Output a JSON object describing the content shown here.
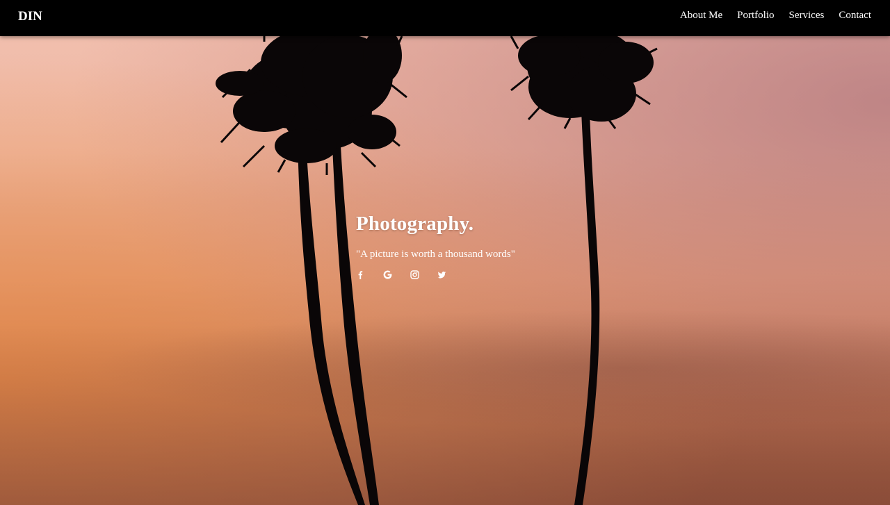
{
  "nav": {
    "brand": "DIN",
    "links": [
      "About Me",
      "Portfolio",
      "Services",
      "Contact"
    ]
  },
  "hero": {
    "title": "Photography.",
    "quote": "\"A picture is worth a thousand words\"",
    "socials": [
      "facebook-icon",
      "google-icon",
      "instagram-icon",
      "twitter-icon"
    ]
  },
  "colors": {
    "navbar": "#000000",
    "text": "#ffffff",
    "sky_top": "#e9b3a2",
    "sky_bottom": "#9a5a42"
  }
}
